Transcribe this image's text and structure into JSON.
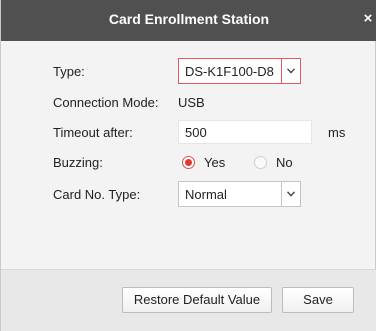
{
  "dialog": {
    "title": "Card Enrollment Station",
    "close_symbol": "×"
  },
  "form": {
    "type": {
      "label": "Type:",
      "value": "DS-K1F100-D8"
    },
    "connection_mode": {
      "label": "Connection Mode:",
      "value": "USB"
    },
    "timeout": {
      "label": "Timeout after:",
      "value": "500",
      "unit": "ms"
    },
    "buzzing": {
      "label": "Buzzing:",
      "options": [
        "Yes",
        "No"
      ],
      "selected": "Yes"
    },
    "card_no_type": {
      "label": "Card No. Type:",
      "value": "Normal"
    }
  },
  "buttons": {
    "restore_label": "Restore Default Value",
    "save_label": "Save"
  },
  "colors": {
    "titlebar": "#505050",
    "accent_red": "#e0392f"
  },
  "icons": {
    "close": "close-icon",
    "dropdown": "chevron-down-icon"
  }
}
